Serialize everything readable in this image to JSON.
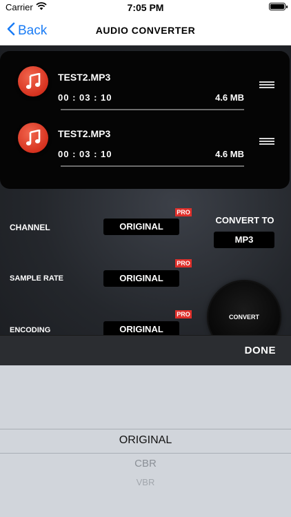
{
  "statusbar": {
    "carrier": "Carrier",
    "time": "7:05 PM"
  },
  "navbar": {
    "back_label": "Back",
    "title": "AUDIO CONVERTER"
  },
  "files": [
    {
      "name": "TEST2.MP3",
      "duration": "00 : 03 : 10",
      "size": "4.6 MB"
    },
    {
      "name": "TEST2.MP3",
      "duration": "00 : 03 : 10",
      "size": "4.6 MB"
    }
  ],
  "settings": {
    "channel": {
      "label": "CHANNEL",
      "value": "ORIGINAL",
      "badge": "PRO"
    },
    "sample_rate": {
      "label": "SAMPLE RATE",
      "value": "ORIGINAL",
      "badge": "PRO"
    },
    "encoding": {
      "label": "ENCODING",
      "value": "ORIGINAL",
      "badge": "PRO"
    }
  },
  "convert_to": {
    "label": "CONVERT TO",
    "value": "MP3"
  },
  "convert_button": "CONVERT",
  "toolbar": {
    "done_label": "DONE"
  },
  "picker": {
    "options": [
      "ORIGINAL",
      "CBR",
      "VBR"
    ],
    "selected": "ORIGINAL"
  },
  "colors": {
    "accent": "#1a7cf5",
    "badge": "#e0302b",
    "file_icon": "#e0402b"
  }
}
